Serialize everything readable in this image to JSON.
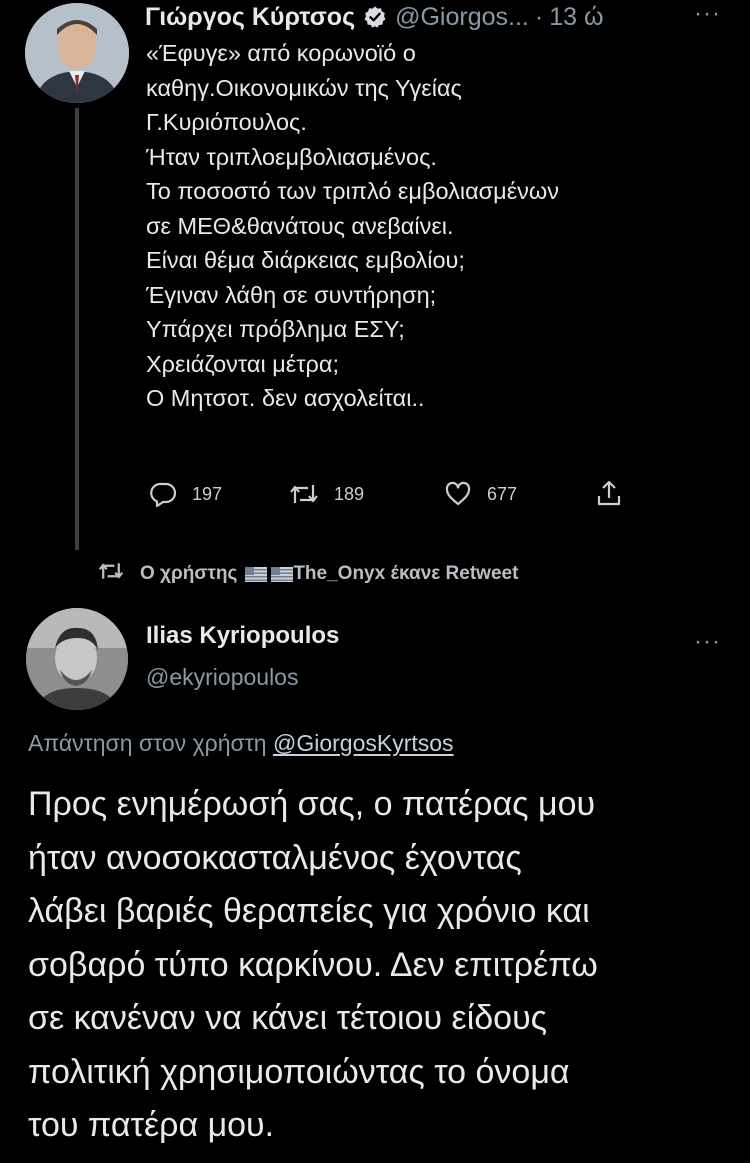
{
  "tweet": {
    "author_name": "Γιώργος Κύρτσος",
    "author_handle": "@Giorgos...",
    "separator": "·",
    "time": "13 ώ",
    "more_label": "···",
    "body_lines": [
      "«Έφυγε» από κορωνοϊό ο",
      "καθηγ.Οικονομικών της Υγείας",
      "Γ.Κυριόπουλος.",
      "Ήταν τριπλοεμβολιασμένος.",
      "Το ποσοστό των τριπλό εμβολιασμένων",
      "σε ΜΕΘ&θανάτους ανεβαίνει.",
      "Είναι θέμα διάρκειας εμβολίου;",
      "Έγιναν λάθη σε συντήρηση;",
      "Υπάρχει πρόβλημα ΕΣΥ;",
      "Χρειάζονται μέτρα;",
      "Ο Μητσοτ. δεν ασχολείται.."
    ],
    "replies": "197",
    "retweets": "189",
    "likes": "677"
  },
  "retweet_banner": {
    "prefix": "Ο χρήστης",
    "suffix": "The_Onyx έκανε Retweet"
  },
  "reply": {
    "author_name": "Ilias Kyriopoulos",
    "author_handle": "@ekyriopoulos",
    "more_label": "···",
    "replying_to_label": "Απάντηση στον χρήστη",
    "replying_to_handle": "@GiorgosKyrtsos",
    "body_lines": [
      "Προς ενημέρωσή σας, ο πατέρας μου",
      "ήταν ανοσοκασταλμένος έχοντας",
      "λάβει βαριές θεραπείες για χρόνιο και",
      "σοβαρό τύπο καρκίνου. Δεν επιτρέπω",
      "σε κανέναν να κάνει τέτοιου είδους",
      "πολιτική χρησιμοποιώντας το όνομα",
      "του πατέρα μου."
    ]
  },
  "colors": {
    "background": "#000000",
    "text": "#e7e9ea",
    "secondary_text": "#8b98a5",
    "verified_badge": "#d9dde2"
  },
  "icons": {
    "verified": "verified-badge-icon",
    "reply": "reply-bubble-icon",
    "retweet": "retweet-icon",
    "like": "heart-icon",
    "share": "share-icon",
    "more": "more-dots-icon"
  }
}
